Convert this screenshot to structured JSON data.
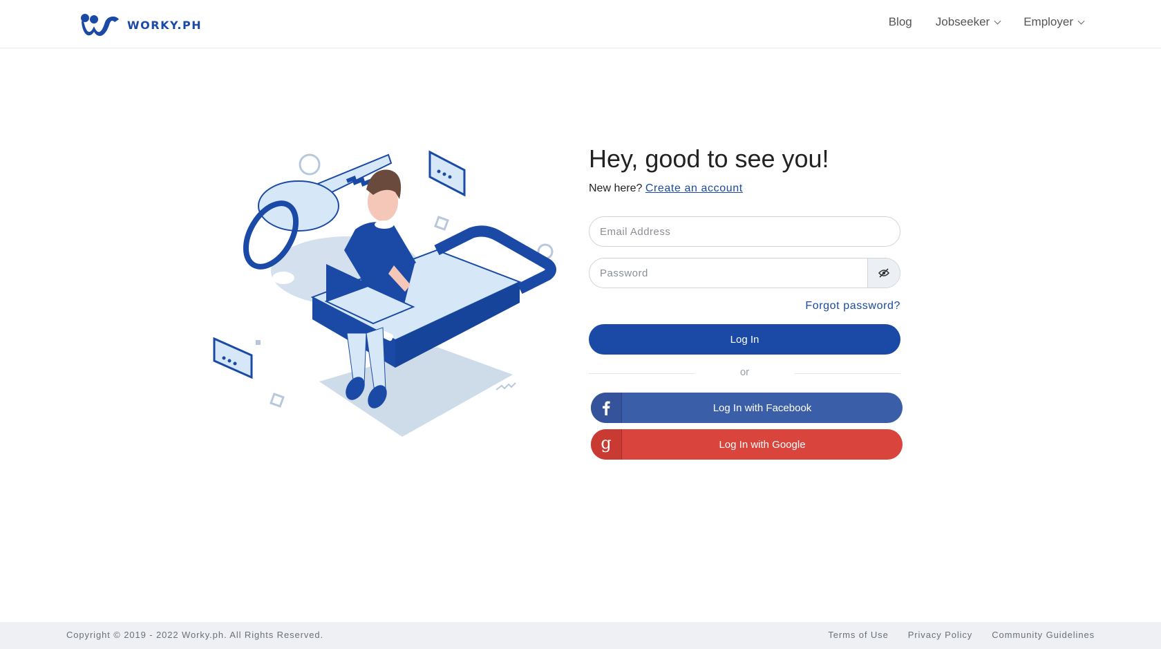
{
  "brand": {
    "name": "WORKY.PH",
    "color": "#1a4aa6"
  },
  "nav": {
    "blog": "Blog",
    "jobseeker": "Jobseeker",
    "employer": "Employer"
  },
  "login": {
    "title": "Hey, good to see you!",
    "new_here": "New here?",
    "create_account": "Create an account",
    "email_placeholder": "Email Address",
    "password_placeholder": "Password",
    "forgot": "Forgot password?",
    "login_button": "Log In",
    "or": "or",
    "facebook_button": "Log In with Facebook",
    "google_button": "Log In with Google"
  },
  "icons": {
    "password_toggle": "eye-slash-icon",
    "facebook": "facebook-icon",
    "google": "google-icon"
  },
  "footer": {
    "copyright": "Copyright © 2019 - 2022 Worky.ph. All Rights Reserved.",
    "terms": "Terms of Use",
    "privacy": "Privacy Policy",
    "community": "Community Guidelines"
  },
  "colors": {
    "primary": "#1a4aa6",
    "facebook": "#3b5ea9",
    "google": "#d9443c"
  }
}
